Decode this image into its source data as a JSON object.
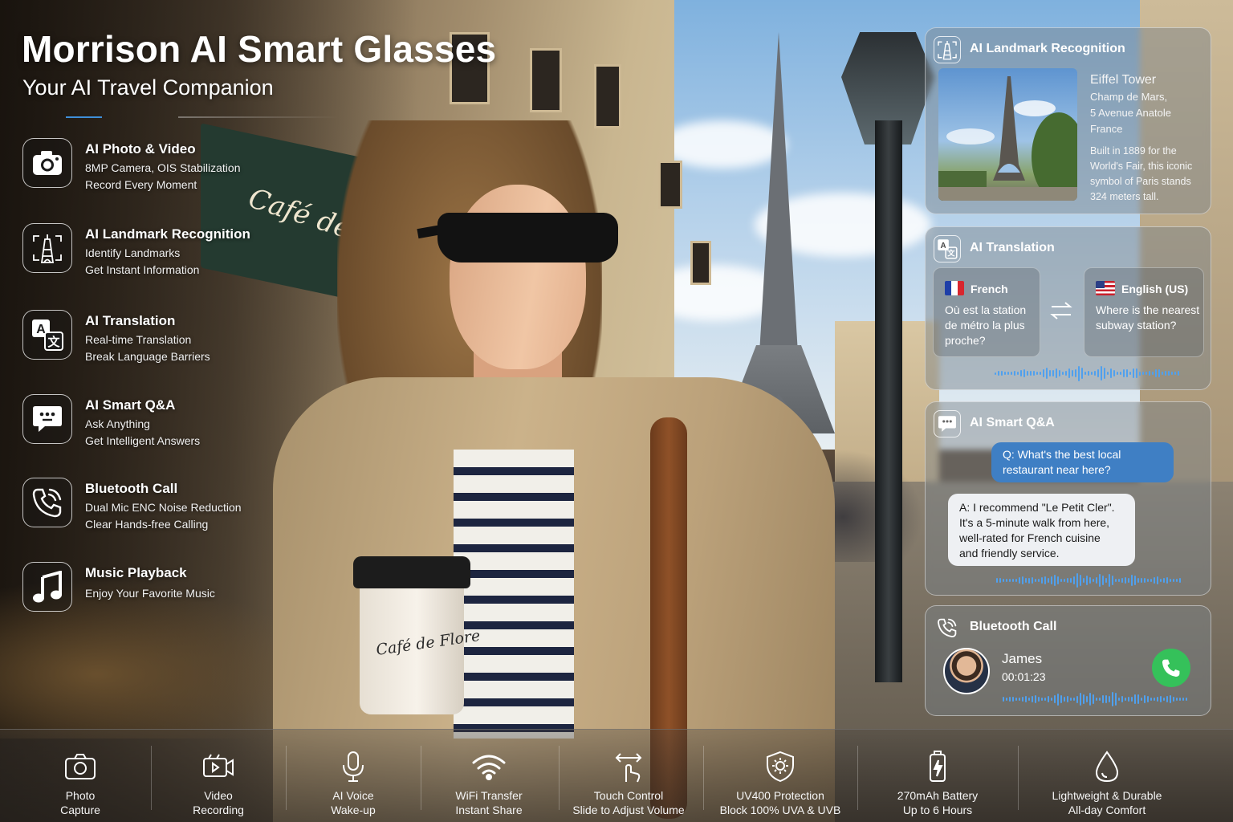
{
  "header": {
    "title": "Morrison AI Smart Glasses",
    "subtitle": "Your AI Travel Companion"
  },
  "features": [
    {
      "icon": "camera-icon",
      "title": "AI Photo & Video",
      "line1": "8MP Camera, OIS Stabilization",
      "line2": "Record Every Moment"
    },
    {
      "icon": "landmark-icon",
      "title": "AI Landmark Recognition",
      "line1": "Identify Landmarks",
      "line2": "Get Instant Information"
    },
    {
      "icon": "translate-icon",
      "title": "AI Translation",
      "line1": "Real-time Translation",
      "line2": "Break Language Barriers"
    },
    {
      "icon": "chat-icon",
      "title": "AI Smart Q&A",
      "line1": "Ask Anything",
      "line2": "Get Intelligent Answers"
    },
    {
      "icon": "phone-icon",
      "title": "Bluetooth Call",
      "line1": "Dual Mic ENC Noise Reduction",
      "line2": "Clear Hands-free Calling"
    },
    {
      "icon": "music-icon",
      "title": "Music Playback",
      "line1": "Enjoy Your Favorite Music",
      "line2": ""
    }
  ],
  "scene": {
    "cafe_sign": "Café de Flore",
    "cup_text": "Café de Flore"
  },
  "landmark_card": {
    "title": "AI Landmark Recognition",
    "name": "Eiffel Tower",
    "address_lines": [
      "Champ de Mars,",
      "5 Avenue Anatole",
      "France"
    ],
    "description_lines": [
      "Built in 1889 for the",
      "World's Fair, this iconic",
      "symbol of Paris stands",
      "324 meters tall."
    ]
  },
  "translation_card": {
    "title": "AI Translation",
    "source": {
      "language": "French",
      "lines": [
        "Où est la station",
        "de métro la plus",
        "proche?"
      ]
    },
    "target": {
      "language": "English (US)",
      "lines": [
        "Where is the nearest",
        "subway station?"
      ]
    }
  },
  "qa_card": {
    "title": "AI Smart Q&A",
    "question_lines": [
      "Q: What's the best local",
      "restaurant near here?"
    ],
    "answer_lines": [
      "A: I recommend \"Le Petit Cler\".",
      "It's a 5-minute walk from here,",
      "well-rated for French cuisine",
      "and friendly service."
    ]
  },
  "call_card": {
    "title": "Bluetooth Call",
    "caller": "James",
    "duration": "00:01:23"
  },
  "bottom_features": [
    {
      "icon": "camera-icon",
      "line1": "Photo",
      "line2": "Capture"
    },
    {
      "icon": "video-icon",
      "line1": "Video",
      "line2": "Recording"
    },
    {
      "icon": "microphone-icon",
      "line1": "AI Voice",
      "line2": "Wake-up"
    },
    {
      "icon": "wifi-icon",
      "line1": "WiFi Transfer",
      "line2": "Instant Share"
    },
    {
      "icon": "touch-icon",
      "line1": "Touch Control",
      "line2": "Slide to Adjust Volume"
    },
    {
      "icon": "shield-icon",
      "line1": "UV400 Protection",
      "line2": "Block 100% UVA & UVB"
    },
    {
      "icon": "battery-icon",
      "line1": "270mAh Battery",
      "line2": "Up to 6 Hours"
    },
    {
      "icon": "droplet-icon",
      "line1": "Lightweight & Durable",
      "line2": "All-day Comfort"
    }
  ],
  "colors": {
    "accent_blue": "#3f7fc4",
    "wave_blue": "#4fa0ee",
    "call_green": "#35c15a"
  }
}
